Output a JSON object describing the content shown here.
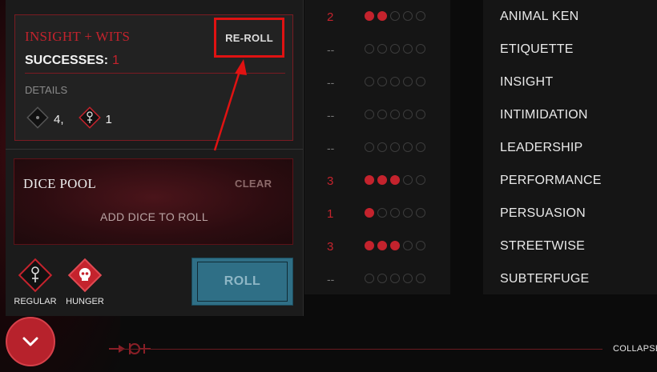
{
  "result": {
    "title": "INSIGHT + WITS",
    "successes_label": "SUCCESSES:",
    "successes_value": "1",
    "details_label": "DETAILS",
    "dice": [
      {
        "icon": "regular-die-icon",
        "count": "4,"
      },
      {
        "icon": "hunger-die-icon",
        "count": "1"
      }
    ],
    "reroll_label": "RE-ROLL"
  },
  "pool": {
    "title": "DICE POOL",
    "clear_label": "CLEAR",
    "placeholder": "ADD DICE TO ROLL"
  },
  "dice_buttons": {
    "regular_label": "REGULAR",
    "hunger_label": "HUNGER"
  },
  "roll_label": "ROLL",
  "collapse_label": "COLLAPSE",
  "dot_rows": [
    {
      "value": "2",
      "filled": 2
    },
    {
      "value": "--",
      "filled": 0
    },
    {
      "value": "--",
      "filled": 0
    },
    {
      "value": "--",
      "filled": 0
    },
    {
      "value": "--",
      "filled": 0
    },
    {
      "value": "3",
      "filled": 3
    },
    {
      "value": "1",
      "filled": 1
    },
    {
      "value": "3",
      "filled": 3
    },
    {
      "value": "--",
      "filled": 0
    }
  ],
  "skills": [
    "ANIMAL KEN",
    "ETIQUETTE",
    "INSIGHT",
    "INTIMIDATION",
    "LEADERSHIP",
    "PERFORMANCE",
    "PERSUASION",
    "STREETWISE",
    "SUBTERFUGE"
  ],
  "colors": {
    "accent": "#c4232d",
    "roll": "#2f6f86",
    "annotation": "#e01212"
  }
}
